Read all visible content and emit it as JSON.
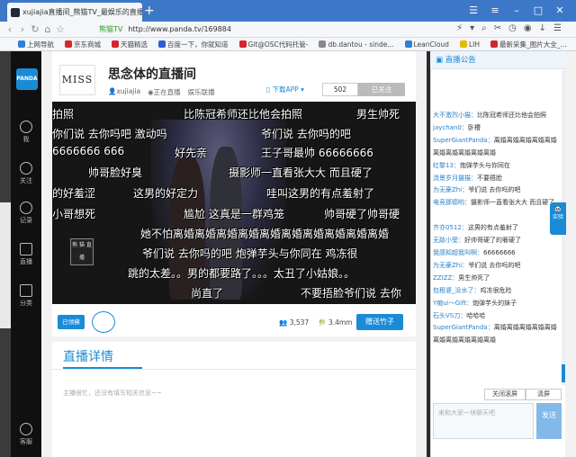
{
  "browser": {
    "tab_title": "xujiajia直播间_熊猫TV_最娱乐的直播",
    "close": "×",
    "new_tab": "+",
    "url_status": "熊猫TV",
    "url": "http://www.panda.tv/169884",
    "bookmarks": [
      {
        "label": "上网导航",
        "color": "#2e7fd6"
      },
      {
        "label": "京东商城",
        "color": "#d3262c"
      },
      {
        "label": "天猫精选",
        "color": "#d3262c"
      },
      {
        "label": "百度一下，你就知道",
        "color": "#2e5fd6"
      },
      {
        "label": "Git@OSC代码托管-",
        "color": "#d3262c"
      },
      {
        "label": "db.dantou - sinde...",
        "color": "#888888"
      },
      {
        "label": "LeanCloud",
        "color": "#2e7fd6"
      },
      {
        "label": "LIH",
        "color": "#e6b800"
      },
      {
        "label": "最新采集_图片大全_...",
        "color": "#d3262c"
      }
    ]
  },
  "sidebar": {
    "logo": "PANDA",
    "items": [
      {
        "label": "我"
      },
      {
        "label": "关注"
      },
      {
        "label": "记录"
      },
      {
        "label": "直播"
      },
      {
        "label": "分类"
      },
      {
        "label": "客服"
      }
    ]
  },
  "room": {
    "avatar_text": "MISS",
    "title": "思念体的直播间",
    "host": "xujiajia",
    "status": "正在直播",
    "category": "娱乐联播",
    "download": "下载APP",
    "fans": "502",
    "follow": "已关注"
  },
  "danmaku": [
    {
      "text": "拍照",
      "cls": "d1"
    },
    {
      "text": "比陈冠希师还比他会拍照",
      "cls": "d2"
    },
    {
      "text": "男生帅死",
      "cls": "d3"
    },
    {
      "text": "你们说 去你吗吧    激动吗",
      "cls": "d4"
    },
    {
      "text": "爷们说 去你吗的吧",
      "cls": "d5"
    },
    {
      "text": "6666666 666",
      "cls": "d6"
    },
    {
      "text": "好先亲",
      "cls": "d7"
    },
    {
      "text": "王子哥最帅     66666666",
      "cls": "d8"
    },
    {
      "text": "帅哥脸好臭",
      "cls": "d9"
    },
    {
      "text": "摄影师一直看张大大 而且硬了",
      "cls": "d10"
    },
    {
      "text": "的好羞涩",
      "cls": "d11"
    },
    {
      "text": "这男的好定力",
      "cls": "d12"
    },
    {
      "text": "哇叫这男的有点羞射了",
      "cls": "d13"
    },
    {
      "text": "小哥想死",
      "cls": "d14"
    },
    {
      "text": "尴尬  这真是一群鸡笼",
      "cls": "d15"
    },
    {
      "text": "帅哥硬了帅哥硬",
      "cls": "d16"
    },
    {
      "text": "她不怕离婚离婚离婚离婚离婚离婚离婚离婚离婚离婚",
      "cls": "d17"
    },
    {
      "text": "爷们说 去你吗的吧     炮弹芋头与你同在   鸡冻很",
      "cls": "d18"
    },
    {
      "text": "跳的太差。。男的都要路了。。。太丑了小姑娘。。",
      "cls": "d19"
    },
    {
      "text": "尚直了",
      "cls": "d20"
    },
    {
      "text": "不要捂脸爷们说 去你",
      "cls": "d21"
    }
  ],
  "video_logo": "熊 猫 直播",
  "controls": {
    "live_label": "已领拂",
    "viewers": "3,537",
    "bamboo": "3.4mm",
    "gift": "赠送竹子"
  },
  "details": {
    "title": "直播详情",
    "empty": "主播很忙，还没有填写相关信息~~"
  },
  "chat": {
    "title": "直播公告",
    "side_label": "实验",
    "messages": [
      {
        "user": "大不激烈小猫：",
        "text": "比陈冠希师还比他会拍照"
      },
      {
        "user": "jaychan0：",
        "text": "卧槽"
      },
      {
        "user": "SuperGiantPanda：",
        "text": "离婚离婚离婚离婚离婚"
      },
      {
        "user": "",
        "text": "离婚离婚离婚离婚离婚"
      },
      {
        "user": "红黎13：",
        "text": "炮弹芋头与你同在"
      },
      {
        "user": "流景岁月摄描：",
        "text": "不要捂脸"
      },
      {
        "user": "为无豪Zhi：",
        "text": "爷们说 去你吗的吧"
      },
      {
        "user": "电竞那德哟：",
        "text": "摄影师一直看张大大 而且硬了"
      },
      {
        "user": "",
        "text": ""
      },
      {
        "user": "齐亦0512：",
        "text": "这男的有点羞射了"
      },
      {
        "user": "无敌小受：",
        "text": "好帅哥硬了的奢硬了"
      },
      {
        "user": "我感知超我叫啊：",
        "text": "66666666"
      },
      {
        "user": "为无豪Zhi：",
        "text": "爷们说 去你吗的吧"
      },
      {
        "user": "ZZIZZ：",
        "text": "男生帅死了"
      },
      {
        "user": "包租婆_没水了：",
        "text": "鸡冻很危险"
      },
      {
        "user": "Y痴ui～Gift：",
        "text": "炮弹芋头的妹子"
      },
      {
        "user": "石头VS刀：",
        "text": "哈哈哈"
      },
      {
        "user": "SuperGiantPanda：",
        "text": "离婚离婚离婚离婚离婚"
      },
      {
        "user": "",
        "text": "离婚离婚离婚离婚离婚"
      }
    ],
    "btn_close": "关闭滚屏",
    "btn_clear": "清屏",
    "input_placeholder": "来和大家一块聊天吧",
    "send": "发送"
  }
}
